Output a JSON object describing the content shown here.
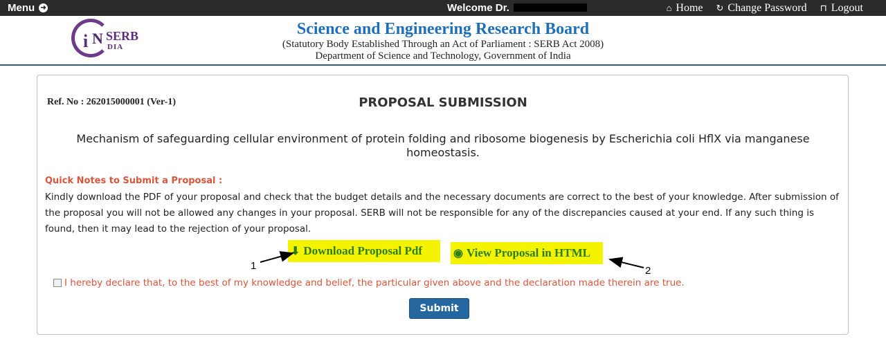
{
  "topbar": {
    "menu_label": "Menu",
    "welcome_text": "Welcome Dr.",
    "links": [
      {
        "label": "Home",
        "icon": "home-icon"
      },
      {
        "label": "Change Password",
        "icon": "refresh-icon"
      },
      {
        "label": "Logout",
        "icon": "unlock-icon"
      }
    ]
  },
  "header": {
    "logo_text_serb": "SERB",
    "logo_text_dia": "DIA",
    "logo_text_i": "i",
    "logo_text_n": "N",
    "title": "Science and Engineering Research Board",
    "subtitle": "(Statutory Body Established Through an Act of Parliament : SERB Act 2008)",
    "dept": "Department of Science and Technology, Government of India"
  },
  "main": {
    "ref_no": "Ref. No : 262015000001 (Ver-1)",
    "page_title": "PROPOSAL SUBMISSION",
    "proposal_title": "Mechanism of safeguarding cellular environment of protein folding and ribosome biogenesis by Escherichia coli HflX via manganese homeostasis.",
    "notes_heading": "Quick Notes to Submit a Proposal :",
    "notes_text": "Kindly download the PDF of your proposal and check that the budget details and the necessary documents are correct to the best of your knowledge. After submission of the proposal you will not be allowed any changes in your proposal. SERB will not be responsible for any of the discrepancies caused at your end. If any such thing is found, then it may lead to the rejection of your proposal.",
    "download_label": "Download Proposal Pdf",
    "view_label": "View Proposal in HTML",
    "annotation_1": "1",
    "annotation_2": "2",
    "declaration": "I hereby declare that, to the best of my  knowledge and belief, the particular given above and the declaration made therein are true.",
    "submit_label": "Submit"
  },
  "colors": {
    "topbar": "#2b2b2b",
    "title_blue": "#1f6fb8",
    "accent_red": "#d9553b",
    "highlight": "#f4f400",
    "link_green": "#2e7d12",
    "submit_bg": "#2467a0"
  }
}
